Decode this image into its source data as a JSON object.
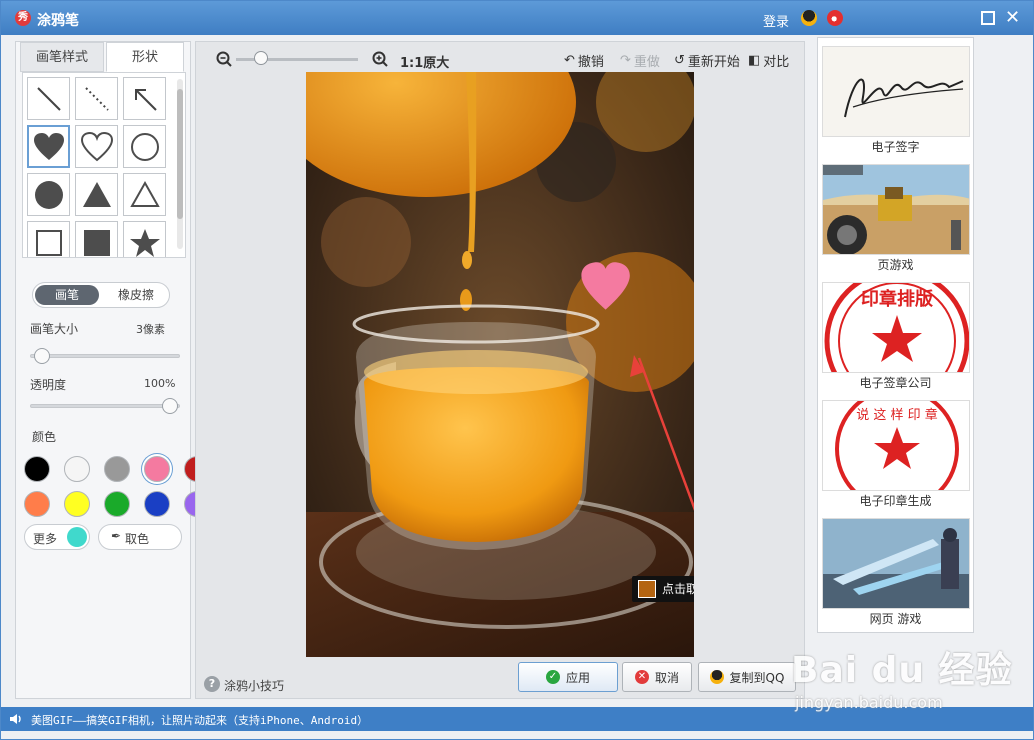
{
  "window": {
    "title": "涂鸦笔",
    "logo_text": "秀",
    "login": "登录"
  },
  "left": {
    "tabs": [
      "画笔样式",
      "形状"
    ],
    "active_tab": "形状",
    "shapes": [
      "line-shape",
      "dotted-line-shape",
      "arrow-shape",
      "heart-filled-shape",
      "heart-outline-shape",
      "circle-outline-shape",
      "circle-filled-shape",
      "triangle-filled-shape",
      "triangle-outline-shape",
      "square-outline-shape",
      "square-filled-shape",
      "star-shape"
    ],
    "selected_shape": "heart-filled-shape",
    "modes": [
      "画笔",
      "橡皮擦"
    ],
    "brush_size_label": "画笔大小",
    "brush_size_value": "3像素",
    "opacity_label": "透明度",
    "opacity_value": "100%",
    "color_label": "颜色",
    "colors": [
      "#000000",
      "#f5f5f5",
      "#999999",
      "#f47aa0",
      "#c01e1e",
      "#ff7d4a",
      "#ffff22",
      "#1aaa2a",
      "#1a3fc4",
      "#9966ee"
    ],
    "selected_color": "#f47aa0",
    "more_label": "更多",
    "more_color": "#40d9cc",
    "picker_label": "取色"
  },
  "center": {
    "zoom_label": "1:1原大",
    "undo": "撤销",
    "redo": "重做",
    "restart": "重新开始",
    "compare": "对比",
    "tooltip": "点击取色",
    "tooltip_color": "#b46411",
    "tips": "涂鸦小技巧",
    "apply": "应用",
    "cancel": "取消",
    "copy_qq": "复制到QQ"
  },
  "right": {
    "ads": [
      {
        "caption": "电子签字",
        "icon": "signature-thumbnail"
      },
      {
        "caption": "页游戏",
        "icon": "truck-game-thumbnail"
      },
      {
        "caption": "电子签章公司",
        "icon": "red-seal-thumbnail"
      },
      {
        "caption": "电子印章生成",
        "icon": "red-stamp-thumbnail"
      },
      {
        "caption": "网页 游戏",
        "icon": "fantasy-game-thumbnail"
      }
    ]
  },
  "status": {
    "text": "美图GIF——搞笑GIF相机，让照片动起来（支持iPhone、Android）"
  },
  "watermark": {
    "logo": "Bai du 经验",
    "url": "jingyan.baidu.com"
  }
}
